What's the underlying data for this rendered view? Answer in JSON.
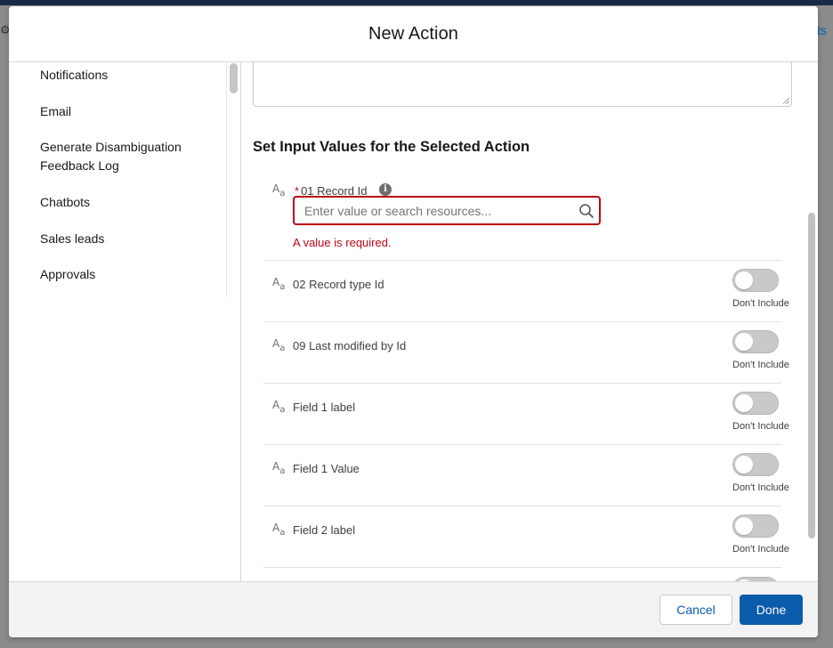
{
  "modal": {
    "title": "New Action"
  },
  "background": {
    "right_link_fragment": "ts"
  },
  "sidebar": {
    "items": [
      {
        "label": "Notifications"
      },
      {
        "label": "Email"
      },
      {
        "label": "Generate Disambiguation Feedback Log"
      },
      {
        "label": "Chatbots"
      },
      {
        "label": "Sales leads"
      },
      {
        "label": "Approvals"
      }
    ]
  },
  "main": {
    "section_heading": "Set Input Values for the Selected Action",
    "type_icon_text": {
      "big": "A",
      "small": "a"
    },
    "required_field": {
      "label": "01 Record Id",
      "required_marker": "*",
      "info_glyph": "i",
      "placeholder": "Enter value or search resources...",
      "value": "",
      "error": "A value is required."
    },
    "optional_fields": [
      {
        "label": "02 Record type Id",
        "toggle_caption": "Don't Include",
        "included": false
      },
      {
        "label": "09 Last modified by Id",
        "toggle_caption": "Don't Include",
        "included": false
      },
      {
        "label": "Field 1 label",
        "toggle_caption": "Don't Include",
        "included": false
      },
      {
        "label": "Field 1 Value",
        "toggle_caption": "Don't Include",
        "included": false
      },
      {
        "label": "Field 2 label",
        "toggle_caption": "Don't Include",
        "included": false
      }
    ]
  },
  "footer": {
    "cancel_label": "Cancel",
    "done_label": "Done"
  },
  "colors": {
    "brand_blue": "#0b5cab",
    "error_red": "#ba0517",
    "toggle_off": "#c9c9c9"
  },
  "icons": [
    "gear-icon",
    "info-icon",
    "search-icon",
    "text-type-icon",
    "resize-grip-icon"
  ]
}
